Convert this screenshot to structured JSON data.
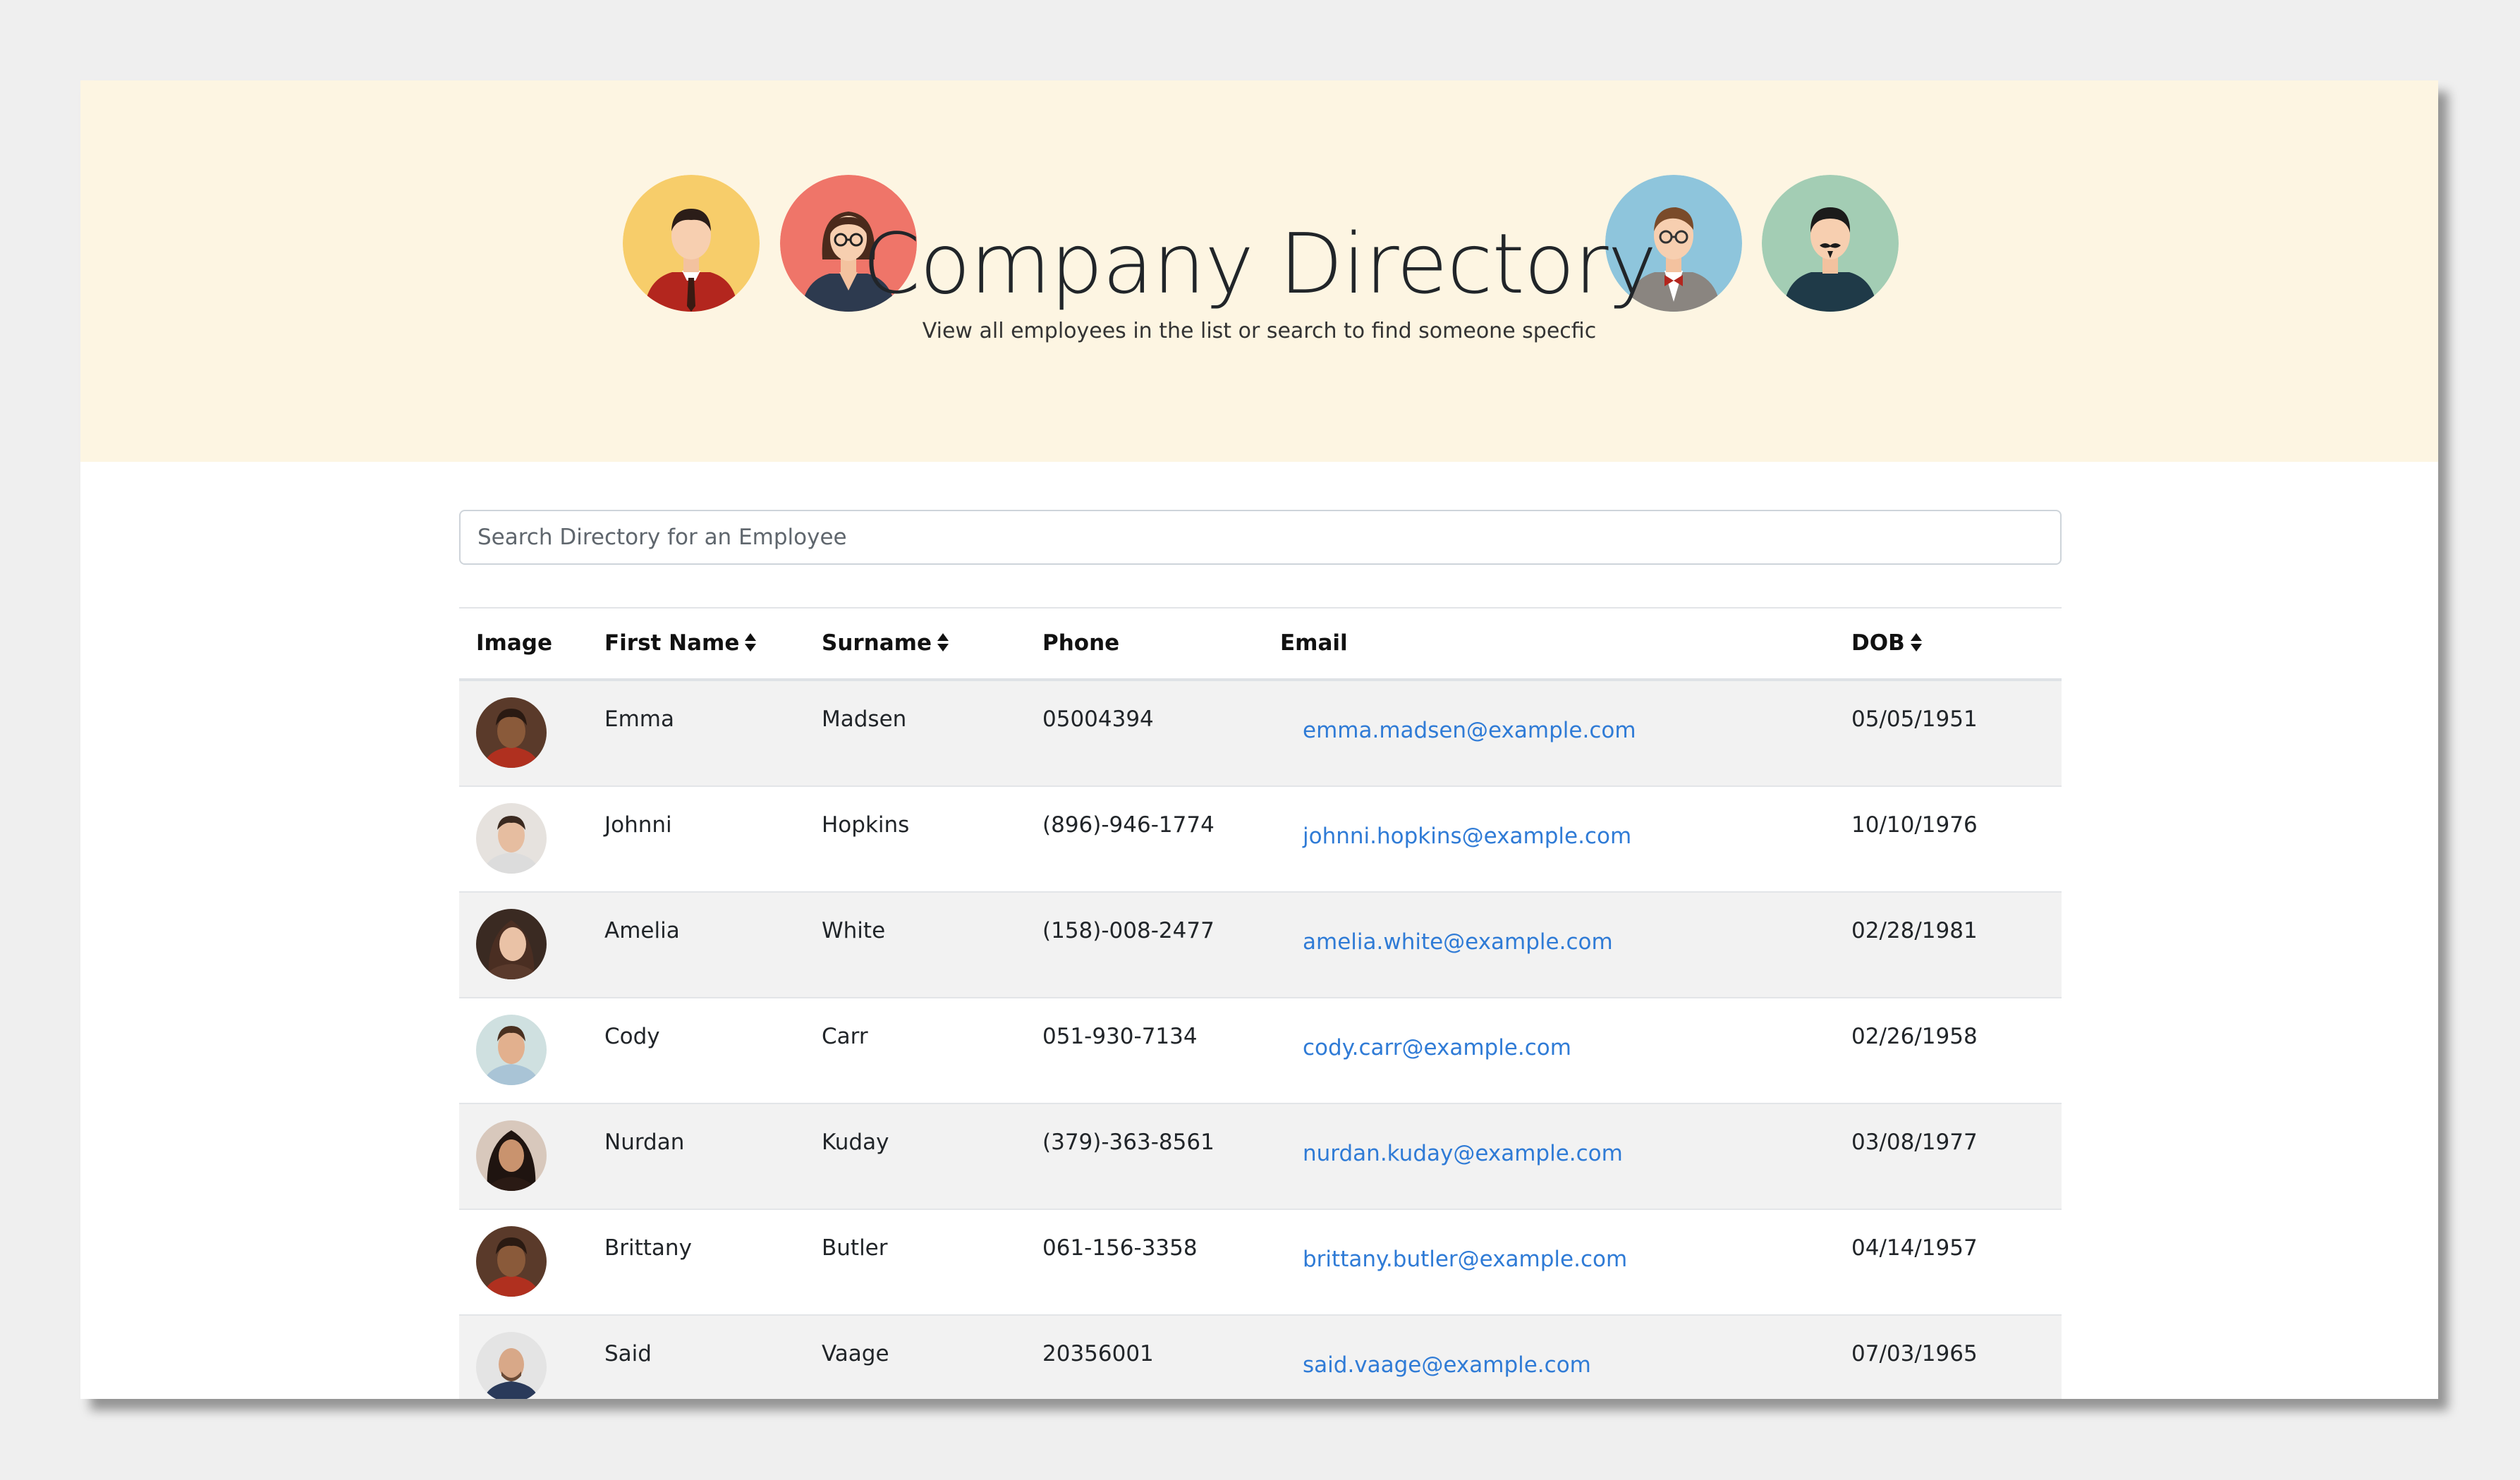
{
  "header": {
    "title": "Company Directory",
    "subtitle": "View all employees in the list or search to find someone specfic",
    "background": "#fdf5e2"
  },
  "search": {
    "placeholder": "Search Directory for an Employee",
    "value": ""
  },
  "table": {
    "columns": [
      {
        "key": "image",
        "label": "Image",
        "sortable": false
      },
      {
        "key": "first",
        "label": "First Name",
        "sortable": true
      },
      {
        "key": "surname",
        "label": "Surname",
        "sortable": true
      },
      {
        "key": "phone",
        "label": "Phone",
        "sortable": false
      },
      {
        "key": "email",
        "label": "Email",
        "sortable": false
      },
      {
        "key": "dob",
        "label": "DOB",
        "sortable": true
      }
    ],
    "rows": [
      {
        "first": "Emma",
        "surname": "Madsen",
        "phone": "05004394",
        "email": "emma.madsen@example.com",
        "dob": "05/05/1951"
      },
      {
        "first": "Johnni",
        "surname": "Hopkins",
        "phone": "(896)-946-1774",
        "email": "johnni.hopkins@example.com",
        "dob": "10/10/1976"
      },
      {
        "first": "Amelia",
        "surname": "White",
        "phone": "(158)-008-2477",
        "email": "amelia.white@example.com",
        "dob": "02/28/1981"
      },
      {
        "first": "Cody",
        "surname": "Carr",
        "phone": "051-930-7134",
        "email": "cody.carr@example.com",
        "dob": "02/26/1958"
      },
      {
        "first": "Nurdan",
        "surname": "Kuday",
        "phone": "(379)-363-8561",
        "email": "nurdan.kuday@example.com",
        "dob": "03/08/1977"
      },
      {
        "first": "Brittany",
        "surname": "Butler",
        "phone": "061-156-3358",
        "email": "brittany.butler@example.com",
        "dob": "04/14/1957"
      },
      {
        "first": "Said",
        "surname": "Vaage",
        "phone": "20356001",
        "email": "said.vaage@example.com",
        "dob": "07/03/1965"
      }
    ]
  },
  "colors": {
    "link": "#2f7bd6",
    "stripe": "#f2f2f2",
    "avatar_yellow": "#f7cd6a",
    "avatar_red": "#ef7569",
    "avatar_blue": "#8ec5dc",
    "avatar_green": "#a3cdb4"
  },
  "icons": {
    "sort": "sort-icon",
    "header_avatars": [
      "man-red-suit-avatar-icon",
      "woman-glasses-avatar-icon",
      "man-bowtie-avatar-icon",
      "man-mustache-avatar-icon"
    ]
  }
}
